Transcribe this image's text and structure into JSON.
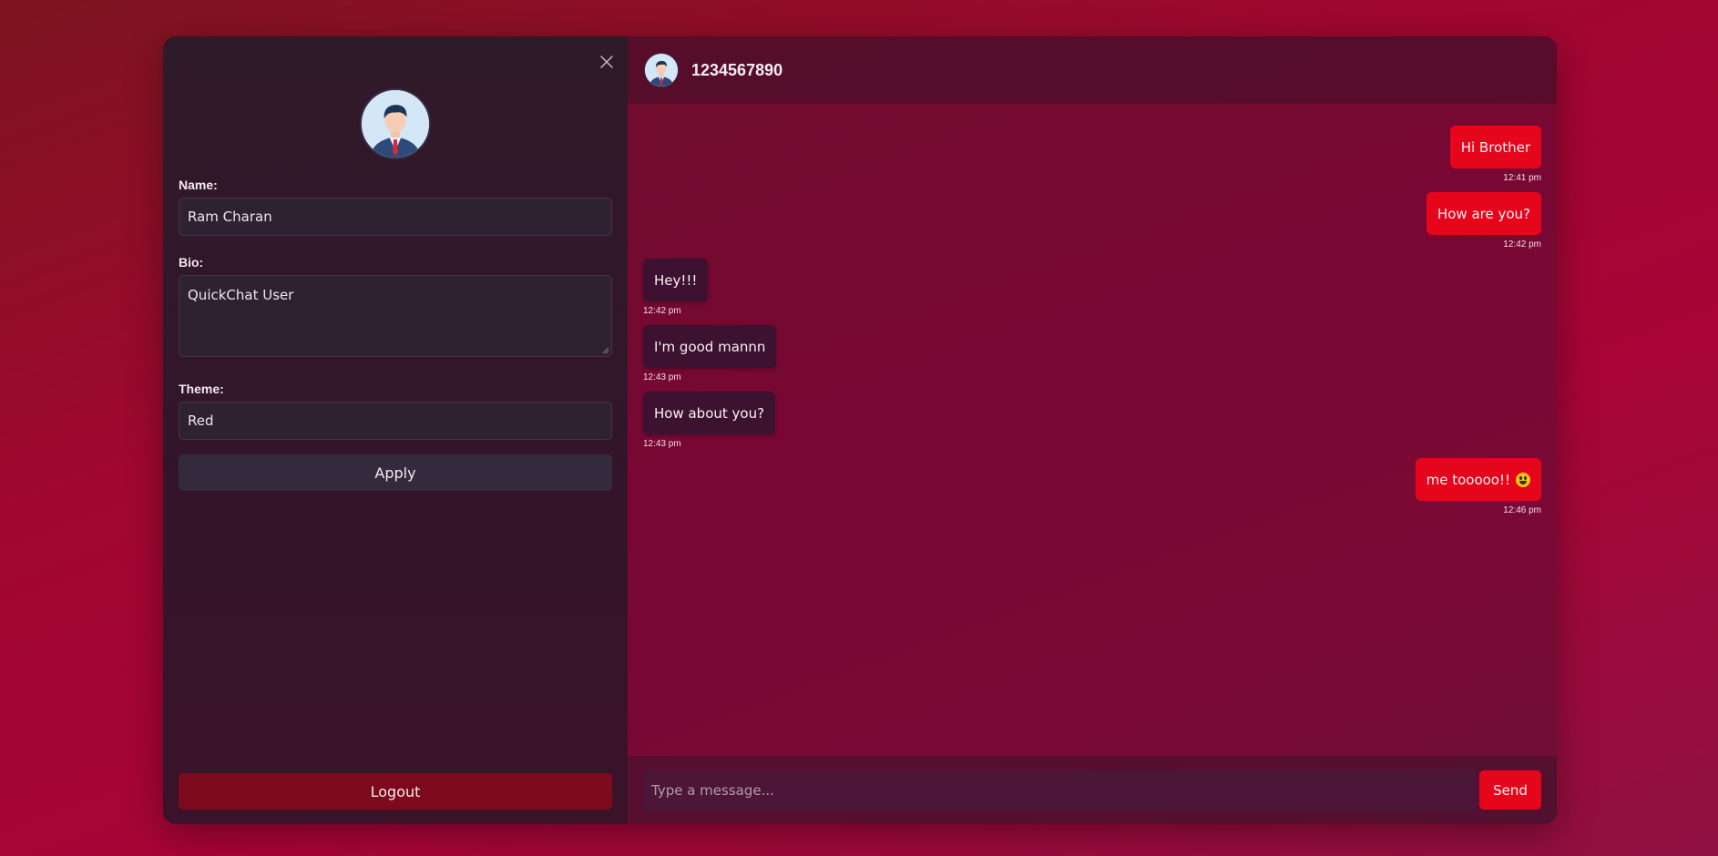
{
  "sidebar": {
    "close_icon": "close-icon",
    "avatar_icon": "user-avatar-icon",
    "name_label": "Name:",
    "name_value": "Ram Charan",
    "bio_label": "Bio:",
    "bio_value": "QuickChat User",
    "theme_label": "Theme:",
    "theme_value": "Red",
    "apply_label": "Apply",
    "logout_label": "Logout"
  },
  "chat": {
    "header": {
      "title": "1234567890",
      "avatar_icon": "user-avatar-icon"
    },
    "messages": [
      {
        "direction": "sent",
        "text": "Hi Brother",
        "time": "12:41 pm"
      },
      {
        "direction": "sent",
        "text": "How are you?",
        "time": "12:42 pm"
      },
      {
        "direction": "received",
        "text": "Hey!!!",
        "time": "12:42 pm"
      },
      {
        "direction": "received",
        "text": "I'm good mannn",
        "time": "12:43 pm"
      },
      {
        "direction": "received",
        "text": "How about you?",
        "time": "12:43 pm"
      },
      {
        "direction": "sent",
        "text": "me tooooo!!",
        "emoji": "grinning-face",
        "time": "12:46 pm"
      }
    ],
    "composer": {
      "placeholder": "Type a message...",
      "send_label": "Send"
    }
  },
  "colors": {
    "accent": "#e5061c",
    "logout": "#7d0a1c",
    "background": "#a0072f"
  }
}
